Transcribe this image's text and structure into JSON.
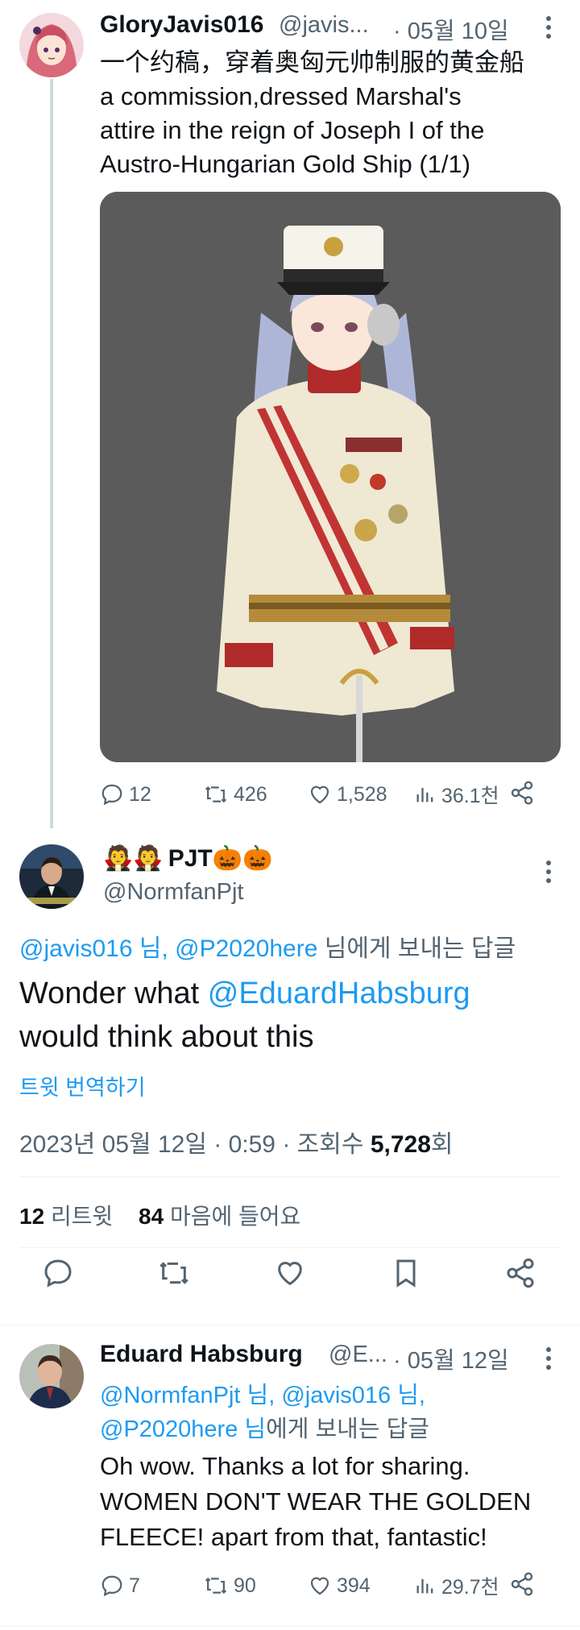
{
  "tweet1": {
    "display_name": "GloryJavis016",
    "handle": "@javis...",
    "date": "· 05월 10일",
    "text_cn": "一个约稿，穿着奥匈元帅制服的黄金船",
    "text_en_1": "a commission,dressed Marshal's",
    "text_en_2": "attire in the reign of Joseph I of the",
    "text_en_3": "Austro-Hungarian Gold Ship (1/1)",
    "replies": "12",
    "retweets": "426",
    "likes": "1,528",
    "views": "36.1천"
  },
  "main": {
    "display_name": "PJT",
    "handle": "@NormfanPjt",
    "reply_to_mentions": "@javis016 님, @P2020here",
    "reply_to_suffix": "님에게 보내는 답글",
    "text_1": "Wonder what",
    "text_mention": "@EduardHabsburg",
    "text_2": "would think about this",
    "translate": "트윗 번역하기",
    "meta_date": "2023년 05월 12일 · 0:59 · 조회수",
    "meta_views": "5,728",
    "meta_views_suffix": "회",
    "retweets_count": "12",
    "retweets_label": "리트윗",
    "likes_count": "84",
    "likes_label": "마음에 들어요"
  },
  "reply": {
    "display_name": "Eduard Habsburg",
    "handle": "@E...",
    "date": "· 05월 12일",
    "reply_to_line1": "@NormfanPjt 님, @javis016 님,",
    "reply_to_line2_mention": "@P2020here 님",
    "reply_to_line2_suffix": "에게 보내는 답글",
    "text_1": "Oh wow. Thanks a lot for sharing.",
    "text_2": "WOMEN DON'T WEAR THE GOLDEN",
    "text_3": "FLEECE! apart from that, fantastic!",
    "replies": "7",
    "retweets": "90",
    "likes": "394",
    "views": "29.7천"
  },
  "colors": {
    "accent": "#1d9bf0",
    "text": "#0f1419",
    "muted": "#536471",
    "divider": "#eff3f4"
  }
}
